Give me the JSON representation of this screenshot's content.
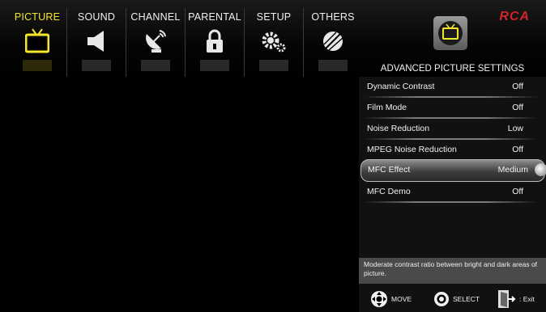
{
  "tabs": [
    {
      "label": "PICTURE",
      "icon": "tv-icon",
      "active": true
    },
    {
      "label": "SOUND",
      "icon": "speaker-icon",
      "active": false
    },
    {
      "label": "CHANNEL",
      "icon": "satellite-dish-icon",
      "active": false
    },
    {
      "label": "PARENTAL",
      "icon": "lock-icon",
      "active": false
    },
    {
      "label": "SETUP",
      "icon": "gears-icon",
      "active": false
    },
    {
      "label": "OTHERS",
      "icon": "others-icon",
      "active": false
    }
  ],
  "brand": {
    "logo_text": "RCA",
    "color": "#d2232a"
  },
  "section": {
    "title": "ADVANCED PICTURE SETTINGS",
    "icon": "tv-icon"
  },
  "settings": [
    {
      "label": "Dynamic Contrast",
      "value": "Off",
      "selected": false
    },
    {
      "label": "Film Mode",
      "value": "Off",
      "selected": false
    },
    {
      "label": "Noise Reduction",
      "value": "Low",
      "selected": false
    },
    {
      "label": "MPEG Noise Reduction",
      "value": "Off",
      "selected": false
    },
    {
      "label": "MFC Effect",
      "value": "Medium",
      "selected": true
    },
    {
      "label": "MFC Demo",
      "value": "Off",
      "selected": false
    }
  ],
  "help_text": "Moderate contrast ratio between bright and dark areas of picture.",
  "legend": {
    "move": "MOVE",
    "select": "SELECT",
    "exit": ": Exit"
  },
  "colors": {
    "active_tab": "#f5e62a",
    "background": "#000000",
    "panel": "#111111"
  }
}
